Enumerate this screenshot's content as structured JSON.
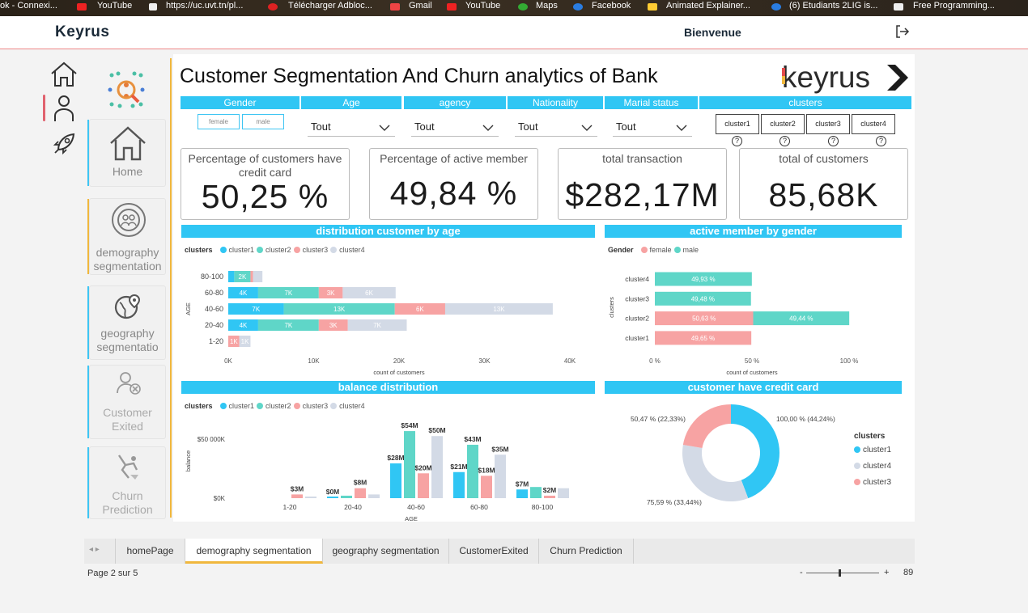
{
  "bookmarks": [
    "ok - Connexi...",
    "YouTube",
    "https://uc.uvt.tn/pl...",
    "Télécharger Adbloc...",
    "Gmail",
    "YouTube",
    "Maps",
    "Facebook",
    "Animated Explainer...",
    "(6) Etudiants 2LIG is...",
    "Free Programming..."
  ],
  "app": {
    "logo": "Keyrus",
    "welcome": "Bienvenue"
  },
  "nav": {
    "tiles": [
      {
        "label": "Home"
      },
      {
        "label": "demography segmentation"
      },
      {
        "label": "geography segmentatio"
      },
      {
        "label": "Customer Exited"
      },
      {
        "label": "Churn Prediction"
      }
    ]
  },
  "report": {
    "title": "Customer Segmentation And Churn analytics of Bank",
    "brand": "keyrus",
    "filters": {
      "headers": [
        "Gender",
        "Age",
        "agency",
        "Nationality",
        "Marial status",
        "clusters"
      ],
      "gender_options": [
        "female",
        "male"
      ],
      "dropdown_value": "Tout",
      "clusters": [
        "cluster1",
        "cluster2",
        "cluster3",
        "cluster4"
      ],
      "help": "?"
    },
    "kpis": [
      {
        "title": "Percentage of customers have credit card",
        "value": "50,25 %"
      },
      {
        "title": "Percentage of active member",
        "value": "49,84 %"
      },
      {
        "title": "total transaction",
        "value": "$282,17M"
      },
      {
        "title": "total of customers",
        "value": "85,68K"
      }
    ]
  },
  "tabs": [
    "homePage",
    "demography segmentation",
    "geography segmentation",
    "CustomerExited",
    "Churn Prediction"
  ],
  "status": {
    "page": "Page 2 sur 5",
    "zoom": "89",
    "minus": "-",
    "plus": "+"
  },
  "colors": {
    "cluster1": "#30c6f4",
    "cluster2": "#5fd6c8",
    "cluster3": "#f7a3a3",
    "cluster4": "#d3dae6",
    "accent": "#30c6f4",
    "gold": "#f0b73d"
  },
  "chart_data": [
    {
      "type": "bar",
      "orientation": "horizontal-stacked",
      "title": "distribution customer by age",
      "legend_title": "clusters",
      "categories": [
        "80-100",
        "60-80",
        "40-60",
        "20-40",
        "1-20"
      ],
      "series": [
        {
          "name": "cluster1",
          "values": [
            0.7,
            3.5,
            6.5,
            3.5,
            0
          ]
        },
        {
          "name": "cluster2",
          "values": [
            1.9,
            7.1,
            13,
            7.1,
            0
          ]
        },
        {
          "name": "cluster3",
          "values": [
            0.3,
            2.8,
            5.9,
            3.4,
            1.3
          ]
        },
        {
          "name": "cluster4",
          "values": [
            1.1,
            6.2,
            12.6,
            6.9,
            1.3
          ]
        }
      ],
      "data_labels": [
        [
          "",
          "2K",
          "",
          ""
        ],
        [
          "4K",
          "7K",
          "3K",
          "6K"
        ],
        [
          "7K",
          "13K",
          "6K",
          "13K"
        ],
        [
          "4K",
          "7K",
          "3K",
          "7K"
        ],
        [
          "",
          "",
          "1K",
          "1K"
        ]
      ],
      "xlabel": "count of customers",
      "ylabel": "AGE",
      "xticks": [
        "0K",
        "10K",
        "20K",
        "30K",
        "40K"
      ],
      "xlim": [
        0,
        40
      ]
    },
    {
      "type": "bar",
      "orientation": "horizontal-stacked-100",
      "title": "active member by gender",
      "legend_title": "Gender",
      "categories": [
        "cluster4",
        "cluster3",
        "cluster2",
        "cluster1"
      ],
      "series": [
        {
          "name": "female",
          "values": [
            0,
            0,
            50.63,
            49.65
          ]
        },
        {
          "name": "male",
          "values": [
            49.93,
            49.48,
            49.44,
            0
          ]
        }
      ],
      "data_labels": [
        [
          "",
          "49,93 %"
        ],
        [
          "",
          "49,48 %"
        ],
        [
          "50,63 %",
          "49,44 %"
        ],
        [
          "49,65 %",
          ""
        ]
      ],
      "xlabel": "count of customers",
      "ylabel": "clusters",
      "xticks": [
        "0 %",
        "50 %",
        "100 %"
      ],
      "xlim": [
        0,
        100
      ]
    },
    {
      "type": "bar",
      "orientation": "vertical-clustered",
      "title": "balance distribution",
      "legend_title": "clusters",
      "categories": [
        "1-20",
        "20-40",
        "40-60",
        "60-80",
        "80-100"
      ],
      "series": [
        {
          "name": "cluster1",
          "values": [
            0,
            0.5,
            28,
            21,
            7
          ]
        },
        {
          "name": "cluster2",
          "values": [
            0,
            2,
            54,
            43,
            9
          ]
        },
        {
          "name": "cluster3",
          "values": [
            3,
            8,
            20,
            18,
            2
          ]
        },
        {
          "name": "cluster4",
          "values": [
            1,
            3,
            50,
            35,
            8
          ]
        }
      ],
      "data_labels": [
        [
          "",
          "",
          "$3M",
          ""
        ],
        [
          "$0M",
          "",
          "$8M",
          ""
        ],
        [
          "$28M",
          "$54M",
          "$20M",
          "$50M"
        ],
        [
          "$21M",
          "$43M",
          "$18M",
          "$35M"
        ],
        [
          "$7M",
          "",
          "$2M",
          ""
        ]
      ],
      "xlabel": "AGE",
      "ylabel": "balance",
      "yticks": [
        "$50 000K",
        "$0K"
      ],
      "ylim": [
        0,
        56
      ]
    },
    {
      "type": "pie",
      "variant": "donut",
      "title": "customer have credit card",
      "legend_title": "clusters",
      "slices": [
        {
          "name": "cluster1",
          "value": 44.24,
          "label": "100,00 % (44,24%)"
        },
        {
          "name": "cluster4",
          "value": 33.44,
          "label": "75,59 % (33,44%)"
        },
        {
          "name": "cluster3",
          "value": 22.33,
          "label": "50,47 % (22,33%)"
        }
      ]
    }
  ]
}
